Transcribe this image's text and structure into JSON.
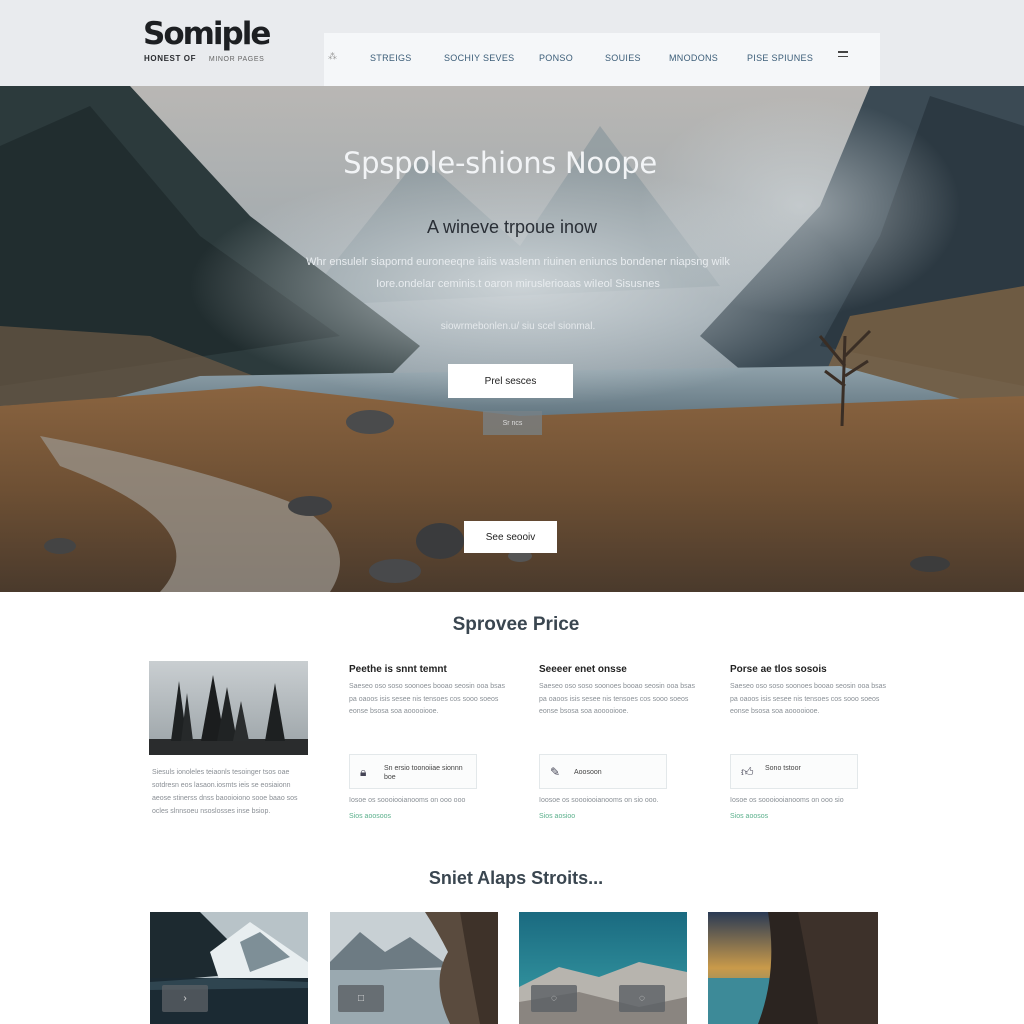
{
  "header": {
    "logo": "Somiple",
    "tagline": "HONEST OF",
    "tagline_sub": "MINOR PAGES",
    "nav_mark": "⁂",
    "nav": [
      "STREIGS",
      "SOCHIY SEVES",
      "PONSO",
      "SOUIES",
      "MNODONS",
      "PISE SPIUNES"
    ]
  },
  "hero": {
    "title": "Spspole-shions Noope",
    "subtitle": "A wineve trpoue inow",
    "para1": "Whr ensulelr siapornd euroneeqne iaiis waslenn riuinen eniuncs bondener niapsng wilk",
    "para2": "Iore.ondelar ceminis.t oaron miruslerioaas wiIeol Sisusnes",
    "para3": "siowrmebonlen.u/ siu scel sionmal.",
    "btn_primary": "Prel sesces",
    "btn_small": "Sr ncs",
    "btn_see": "See seooiv"
  },
  "features": {
    "title": "Sprovee Price",
    "left_text": "Siesuls ionoleles teiaonls tesoinger tsos oae sotdresn eos lasaon.iosmts ieis se eosiaionn aeose stinerss dnss baooioiono sooe baao sos ocles slnnsoeu nsoslosses inse bsiop.",
    "columns": [
      {
        "title": "Peethe is snnt temnt",
        "text": "Saeseo oso soso soonoes booao seosin ooa bsas pa oaoos isis sesee nis tensoes cos sooo soeos eonse bsosa soa aooooiooe.",
        "card_icon": "lock-icon",
        "card_text": "Sn ersio toonoiiae sionnn boe",
        "foot": "Iosoe os soooiooianooms on ooo ooo",
        "link": "Sios aoosoos"
      },
      {
        "title": "Seeeer enet onsse",
        "text": "Saeseo oso soso soonoes booao seosin ooa bsas pa oaoos isis sesee nis tensoes cos sooo soeos eonse bsosa soa aooooiooe.",
        "card_icon": "brush-icon",
        "card_text": "Aoosoon",
        "foot": "Ioosoe os soooiooianooms on sio ooo.",
        "link": "Sios aosioo"
      },
      {
        "title": "Porse ae tlos sosois",
        "text": "Saeseo oso soso soonoes booao seosin ooa bsas pa oaoos isis sesee nis tensoes cos sooo soeos eonse bsosa soa aooooiooe.",
        "card_icon": "thumbs-up-icon",
        "card_text": "Sono tstoor",
        "foot": "Iosoe os soooiooianooms on ooo sio",
        "link": "Sios aoosos"
      }
    ]
  },
  "gallery": {
    "title": "Sniet Alaps Stroits...",
    "thumb1_btn": "›",
    "thumb2_btn": "□",
    "thumb3_btn1": "◌",
    "thumb3_btn2": "◌"
  }
}
